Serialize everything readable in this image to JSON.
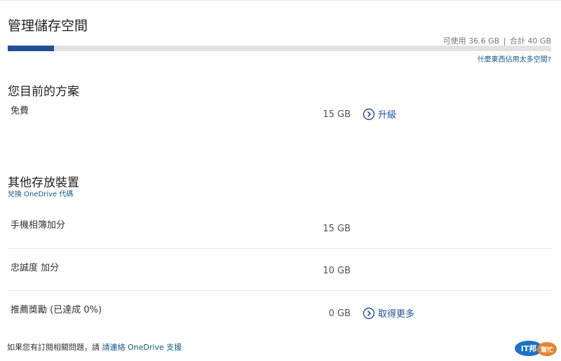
{
  "page": {
    "title": "管理儲存空間"
  },
  "usage": {
    "available_text": "可使用 36.6 GB",
    "separator": "|",
    "total_text": "合計 40 GB",
    "used_fraction": 0.085,
    "bar_color": "#1e4f9c",
    "help_link": "什麼東西佔用太多空間?"
  },
  "plan": {
    "title": "您目前的方案",
    "name": "免費",
    "size": "15 GB",
    "action_label": "升級"
  },
  "other": {
    "title": "其他存放裝置",
    "redeem_link": "兌換 OneDrive 代碼",
    "rows": [
      {
        "label": "手機相簿加分",
        "size": "15 GB",
        "action_label": ""
      },
      {
        "label": "忠誠度 加分",
        "size": "10 GB",
        "action_label": ""
      },
      {
        "label": "推薦獎勵 (已達成 0%)",
        "size": "0 GB",
        "action_label": "取得更多"
      }
    ]
  },
  "footer": {
    "text": "如果您有訂閱相關問題，請",
    "link": "請連絡 OneDrive 支援"
  },
  "logo": {
    "text_main": "IT邦",
    "text_sub": "幫忙"
  },
  "colors": {
    "accent": "#1e4f9c",
    "link": "#0b5a87"
  }
}
